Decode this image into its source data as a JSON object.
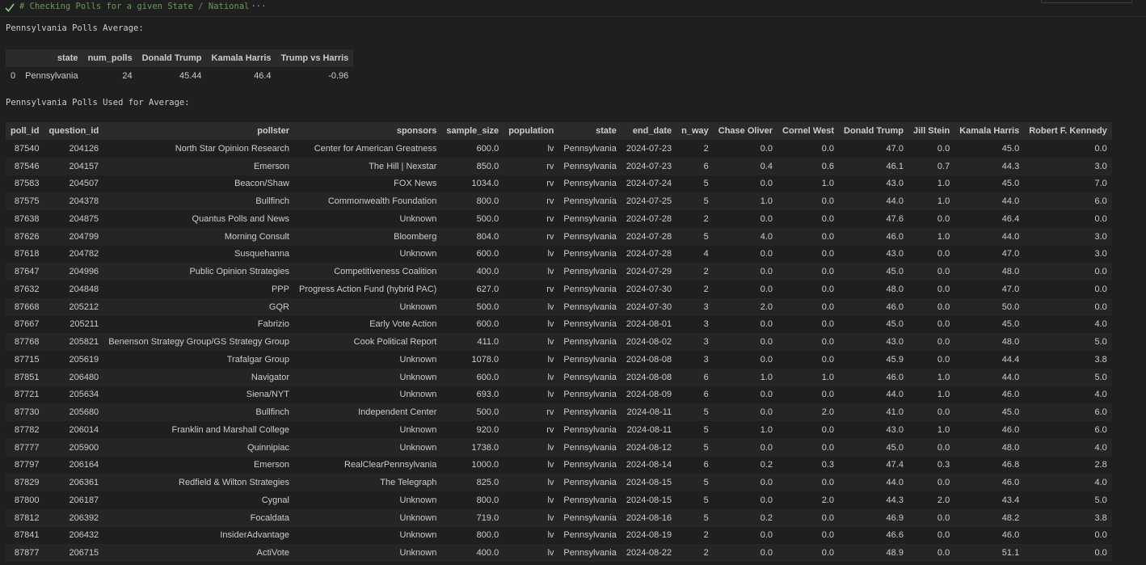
{
  "cell": {
    "collapsed_source": "# Checking Polls for a given State / National",
    "ellipsis": "···"
  },
  "output": {
    "heading_average": "Pennsylvania Polls Average:",
    "heading_used": "Pennsylvania Polls Used for Average:"
  },
  "average_table": {
    "columns": [
      "",
      "state",
      "num_polls",
      "Donald Trump",
      "Kamala Harris",
      "Trump vs Harris"
    ],
    "rows": [
      [
        "0",
        "Pennsylvania",
        "24",
        "45.44",
        "46.4",
        "-0.96"
      ]
    ]
  },
  "polls_table": {
    "columns": [
      "poll_id",
      "question_id",
      "pollster",
      "sponsors",
      "sample_size",
      "population",
      "state",
      "end_date",
      "n_way",
      "Chase Oliver",
      "Cornel West",
      "Donald Trump",
      "Jill Stein",
      "Kamala Harris",
      "Robert F. Kennedy"
    ],
    "rows": [
      [
        "87540",
        "204126",
        "North Star Opinion Research",
        "Center for American Greatness",
        "600.0",
        "lv",
        "Pennsylvania",
        "2024-07-23",
        "2",
        "0.0",
        "0.0",
        "47.0",
        "0.0",
        "45.0",
        "0.0"
      ],
      [
        "87546",
        "204157",
        "Emerson",
        "The Hill | Nexstar",
        "850.0",
        "rv",
        "Pennsylvania",
        "2024-07-23",
        "6",
        "0.4",
        "0.6",
        "46.1",
        "0.7",
        "44.3",
        "3.0"
      ],
      [
        "87583",
        "204507",
        "Beacon/Shaw",
        "FOX News",
        "1034.0",
        "rv",
        "Pennsylvania",
        "2024-07-24",
        "5",
        "0.0",
        "1.0",
        "43.0",
        "1.0",
        "45.0",
        "7.0"
      ],
      [
        "87575",
        "204378",
        "Bullfinch",
        "Commonwealth Foundation",
        "800.0",
        "rv",
        "Pennsylvania",
        "2024-07-25",
        "5",
        "1.0",
        "0.0",
        "44.0",
        "1.0",
        "44.0",
        "6.0"
      ],
      [
        "87638",
        "204875",
        "Quantus Polls and News",
        "Unknown",
        "500.0",
        "rv",
        "Pennsylvania",
        "2024-07-28",
        "2",
        "0.0",
        "0.0",
        "47.6",
        "0.0",
        "46.4",
        "0.0"
      ],
      [
        "87626",
        "204799",
        "Morning Consult",
        "Bloomberg",
        "804.0",
        "rv",
        "Pennsylvania",
        "2024-07-28",
        "5",
        "4.0",
        "0.0",
        "46.0",
        "1.0",
        "44.0",
        "3.0"
      ],
      [
        "87618",
        "204782",
        "Susquehanna",
        "Unknown",
        "600.0",
        "lv",
        "Pennsylvania",
        "2024-07-28",
        "4",
        "0.0",
        "0.0",
        "43.0",
        "0.0",
        "47.0",
        "3.0"
      ],
      [
        "87647",
        "204996",
        "Public Opinion Strategies",
        "Competitiveness Coalition",
        "400.0",
        "lv",
        "Pennsylvania",
        "2024-07-29",
        "2",
        "0.0",
        "0.0",
        "45.0",
        "0.0",
        "48.0",
        "0.0"
      ],
      [
        "87632",
        "204848",
        "PPP",
        "Progress Action Fund (hybrid PAC)",
        "627.0",
        "rv",
        "Pennsylvania",
        "2024-07-30",
        "2",
        "0.0",
        "0.0",
        "48.0",
        "0.0",
        "47.0",
        "0.0"
      ],
      [
        "87668",
        "205212",
        "GQR",
        "Unknown",
        "500.0",
        "lv",
        "Pennsylvania",
        "2024-07-30",
        "3",
        "2.0",
        "0.0",
        "46.0",
        "0.0",
        "50.0",
        "0.0"
      ],
      [
        "87667",
        "205211",
        "Fabrizio",
        "Early Vote Action",
        "600.0",
        "lv",
        "Pennsylvania",
        "2024-08-01",
        "3",
        "0.0",
        "0.0",
        "45.0",
        "0.0",
        "45.0",
        "4.0"
      ],
      [
        "87768",
        "205821",
        "Benenson Strategy Group/GS Strategy Group",
        "Cook Political Report",
        "411.0",
        "lv",
        "Pennsylvania",
        "2024-08-02",
        "3",
        "0.0",
        "0.0",
        "43.0",
        "0.0",
        "48.0",
        "5.0"
      ],
      [
        "87715",
        "205619",
        "Trafalgar Group",
        "Unknown",
        "1078.0",
        "lv",
        "Pennsylvania",
        "2024-08-08",
        "3",
        "0.0",
        "0.0",
        "45.9",
        "0.0",
        "44.4",
        "3.8"
      ],
      [
        "87851",
        "206480",
        "Navigator",
        "Unknown",
        "600.0",
        "lv",
        "Pennsylvania",
        "2024-08-08",
        "6",
        "1.0",
        "1.0",
        "46.0",
        "1.0",
        "44.0",
        "5.0"
      ],
      [
        "87721",
        "205634",
        "Siena/NYT",
        "Unknown",
        "693.0",
        "lv",
        "Pennsylvania",
        "2024-08-09",
        "6",
        "0.0",
        "0.0",
        "44.0",
        "1.0",
        "46.0",
        "4.0"
      ],
      [
        "87730",
        "205680",
        "Bullfinch",
        "Independent Center",
        "500.0",
        "rv",
        "Pennsylvania",
        "2024-08-11",
        "5",
        "0.0",
        "2.0",
        "41.0",
        "0.0",
        "45.0",
        "6.0"
      ],
      [
        "87782",
        "206014",
        "Franklin and Marshall College",
        "Unknown",
        "920.0",
        "rv",
        "Pennsylvania",
        "2024-08-11",
        "5",
        "1.0",
        "0.0",
        "43.0",
        "1.0",
        "46.0",
        "6.0"
      ],
      [
        "87777",
        "205900",
        "Quinnipiac",
        "Unknown",
        "1738.0",
        "lv",
        "Pennsylvania",
        "2024-08-12",
        "5",
        "0.0",
        "0.0",
        "45.0",
        "0.0",
        "48.0",
        "4.0"
      ],
      [
        "87797",
        "206164",
        "Emerson",
        "RealClearPennsylvania",
        "1000.0",
        "lv",
        "Pennsylvania",
        "2024-08-14",
        "6",
        "0.2",
        "0.3",
        "47.4",
        "0.3",
        "46.8",
        "2.8"
      ],
      [
        "87829",
        "206361",
        "Redfield & Wilton Strategies",
        "The Telegraph",
        "825.0",
        "lv",
        "Pennsylvania",
        "2024-08-15",
        "5",
        "0.0",
        "0.0",
        "44.0",
        "0.0",
        "46.0",
        "4.0"
      ],
      [
        "87800",
        "206187",
        "Cygnal",
        "Unknown",
        "800.0",
        "lv",
        "Pennsylvania",
        "2024-08-15",
        "5",
        "0.0",
        "2.0",
        "44.3",
        "2.0",
        "43.4",
        "5.0"
      ],
      [
        "87812",
        "206392",
        "Focaldata",
        "Unknown",
        "719.0",
        "lv",
        "Pennsylvania",
        "2024-08-16",
        "5",
        "0.2",
        "0.0",
        "46.9",
        "0.0",
        "48.2",
        "3.8"
      ],
      [
        "87841",
        "206432",
        "InsiderAdvantage",
        "Unknown",
        "800.0",
        "lv",
        "Pennsylvania",
        "2024-08-19",
        "2",
        "0.0",
        "0.0",
        "46.6",
        "0.0",
        "46.0",
        "0.0"
      ],
      [
        "87877",
        "206715",
        "ActiVote",
        "Unknown",
        "400.0",
        "lv",
        "Pennsylvania",
        "2024-08-22",
        "2",
        "0.0",
        "0.0",
        "48.9",
        "0.0",
        "51.1",
        "0.0"
      ]
    ]
  },
  "colors": {
    "background": "#1f1f1f",
    "text": "#cccccc",
    "comment_green": "#6a9955",
    "check_green": "#89d185",
    "header_row_bg": "#2b2b2b",
    "stripe_bg": "#252525"
  },
  "icons": {
    "cell_status": "check-icon"
  }
}
